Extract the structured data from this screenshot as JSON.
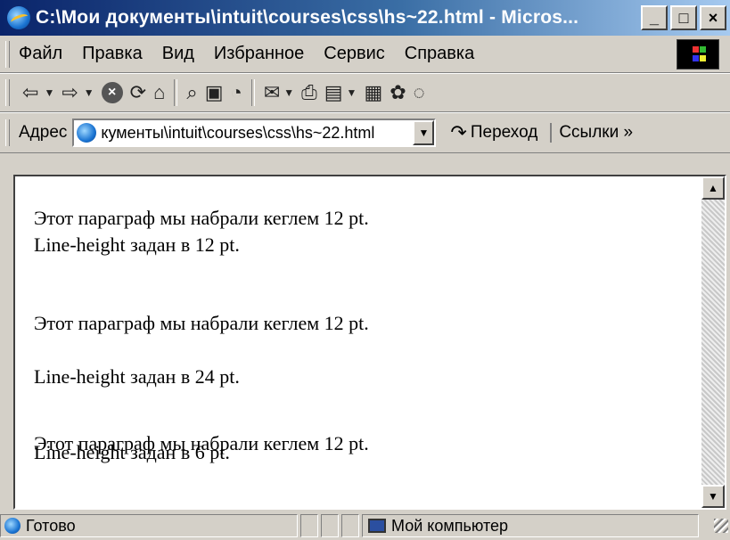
{
  "window": {
    "title": "C:\\Мои документы\\intuit\\courses\\css\\hs~22.html - Micros...",
    "buttons": [
      "_",
      "□",
      "×"
    ]
  },
  "menu": {
    "items": [
      {
        "label": "Файл"
      },
      {
        "label": "Правка"
      },
      {
        "label": "Вид"
      },
      {
        "label": "Избранное"
      },
      {
        "label": "Сервис"
      },
      {
        "label": "Справка"
      }
    ]
  },
  "toolbar": {
    "icons": [
      "back-icon",
      "forward-icon",
      "stop-icon",
      "refresh-icon",
      "home-icon",
      "search-icon",
      "favorites-icon",
      "history-icon",
      "mail-icon",
      "print-icon",
      "edit-icon",
      "discuss-icon",
      "messenger-icon",
      "chat-icon"
    ]
  },
  "address": {
    "label": "Адрес",
    "value": "кументы\\intuit\\courses\\css\\hs~22.html",
    "go_label": "Переход",
    "links_label": "Ссылки »"
  },
  "content": {
    "p1_line1": "Этот параграф мы набрали кеглем 12 pt.",
    "p1_line2": "Line-height задан в 12 pt.",
    "p2_line1": "Этот параграф мы набрали кеглем 12 pt.",
    "p2_line2": "Line-height задан в 24 pt.",
    "p3_line1": "Этот параграф мы набрали кеглем 12 pt.",
    "p3_line2": "Line-height задан в 6 pt."
  },
  "status": {
    "text": "Готово",
    "zone": "Мой компьютер"
  },
  "colors": {
    "titlebar_start": "#0a246a",
    "titlebar_end": "#a6caf0",
    "chrome": "#d4d0c8"
  }
}
